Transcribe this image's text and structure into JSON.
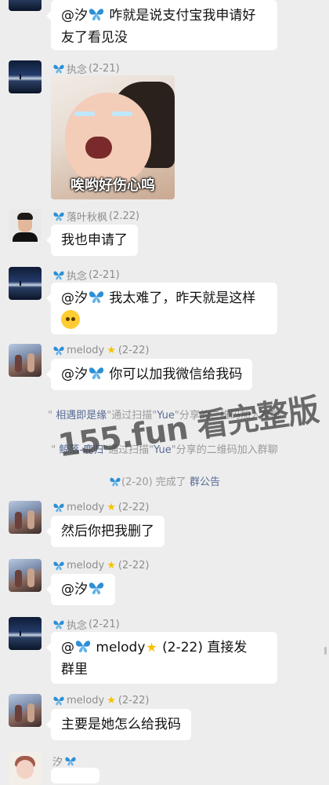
{
  "messages": [
    {
      "text": "@汐",
      "text_after": " 咋就是说支付宝我申请好友了看见没"
    },
    {
      "sender": "执念",
      "time": "(2-21)",
      "sticker_caption": "唉哟好伤心呜"
    },
    {
      "sender": "落叶秋枫",
      "time": "(2.22)",
      "text": "我也申请了"
    },
    {
      "sender": "执念",
      "time": "(2-21)",
      "text": "@汐",
      "text_after": " 我太难了，昨天就是这样"
    },
    {
      "sender": "melody",
      "time": "(2-22)",
      "text": "@汐",
      "text_after": " 你可以加我微信给我码"
    },
    {
      "sender": "melody",
      "time": "(2-22)",
      "text": "然后你把我删了"
    },
    {
      "sender": "melody",
      "time": "(2-22)",
      "text": "@汐"
    },
    {
      "sender": "执念",
      "time": "(2-21)",
      "text": "@",
      "text_mid": " melody",
      "text_after": " (2-22)  直接发",
      "text_line2": "群里"
    },
    {
      "sender": "melody",
      "time": "(2-22)",
      "text": "主要是她怎么给我码"
    },
    {
      "sender": "汐"
    }
  ],
  "system": [
    {
      "pre": "\" ",
      "name": "相遇即是缘",
      "mid": "\"通过扫描\"",
      "name2": "Yue",
      "post": "\"分享的二维码加入群聊"
    },
    {
      "pre": "\" ",
      "name": "鲸落-鹿归",
      "mid": "\"通过扫描\"",
      "name2": "Yue",
      "post": "\"分享的二维码加入群聊"
    },
    {
      "pre": "",
      "name": "",
      "mid": "(2-20) 完成了 ",
      "name2": "群公告",
      "post": ""
    }
  ],
  "watermark": "155.fun 看完整版",
  "colors": {
    "bg": "#ededed",
    "bubble": "#ffffff",
    "link": "#576b95",
    "butterfly": "#2d8fd5"
  }
}
